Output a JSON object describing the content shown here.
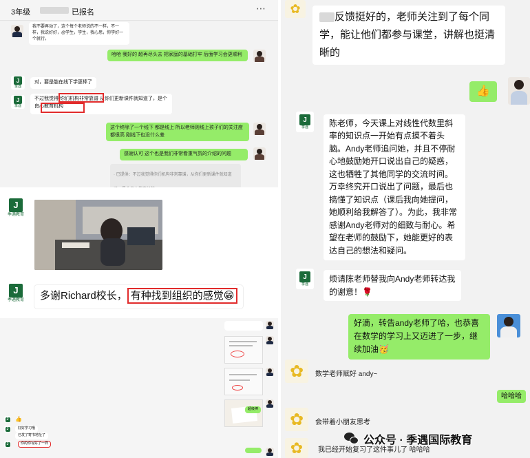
{
  "top_left_chat": {
    "title": "3年级",
    "title_suffix": "已报名",
    "messages": [
      {
        "text": "我不要再动了，这个每个老师说的不一样，不一样，我说好好，@学生，学生，我心思，你学好一个就行。"
      },
      {
        "text": "哈哈 我好的 超再尽头去 把家庭的基础打牢 后面学习会更顺利"
      },
      {
        "text": "对，要是能在线下学更棒了"
      },
      {
        "text": "不过我觉得 你们机构非常靠谱 从你们更新课件就知道了，是个良心教育机构"
      },
      {
        "text": "这个终除了一个线下 都是线上 所以老师则线上孩子们的关注度都很高 刚线下也没什么差"
      },
      {
        "text": "感谢认可 这个也是我们非常看重气氛的介绍的问题"
      },
      {
        "text": "· 已提供：不过我觉得你们机构非常靠谱，从你们更新课件就知道了，是个良心教育机构"
      }
    ],
    "highlights": [
      "你们机构非常靠谱",
      "良心教育机构"
    ]
  },
  "middle_left_chat": {
    "logo_text": "季遇教育",
    "message": "多谢Richard校长，有种找到组织的感觉😁",
    "message_plain": "多谢Richard校长，",
    "message_highlight": "有种找到组织的感觉😁"
  },
  "bottom_left_chat": {
    "items": [
      {
        "text": "超级棒"
      },
      {
        "text": "好好学习哦"
      },
      {
        "text": "已发了寄书地址了"
      },
      {
        "text": "你的你写好了一样"
      }
    ],
    "emoji": "👍"
  },
  "right_chat": {
    "messages": [
      {
        "side": "left",
        "text": "反馈挺好的，老师关注到了每个同学，能让他们都参与课堂，讲解也挺清晰的"
      },
      {
        "side": "right",
        "text": "👍"
      },
      {
        "side": "left",
        "text": "陈老师，今天课上对线性代数里斜率的知识点一开始有点摸不着头脑。Andy老师追问她，并且不停耐心地鼓励她开口说出自己的疑惑，这也牺牲了其他同学的交流时间。万幸终究开口说出了问题，最后也搞懂了知识点（课后我向她提问，她顺利给我解答了）。为此，我非常感谢Andy老师对的细致与耐心。希望在老师的鼓励下，她能更好的表达自己的想法和疑问。"
      },
      {
        "side": "left",
        "text": "烦请陈老师替我向Andy老师转达我的谢意！🌹"
      },
      {
        "side": "right",
        "text": "好滴，转告andy老师了哈，也恭喜在数学的学习上又迈进了一步，继续加油🥳"
      },
      {
        "side": "left",
        "text": "数学老师赋好 andy~"
      },
      {
        "side": "right",
        "text": "哈哈哈"
      },
      {
        "side": "left",
        "text": "会带着小朋友思考"
      },
      {
        "side": "left",
        "text": "我已经开始复习了这件事儿了 哈哈哈"
      }
    ]
  },
  "watermark": {
    "icon": "wechat-icon",
    "text": "公众号 · 季遇国际教育"
  },
  "colors": {
    "wechat_green": "#95ec69",
    "highlight_red": "#e12b2b",
    "brand_green": "#1b6b3a"
  }
}
